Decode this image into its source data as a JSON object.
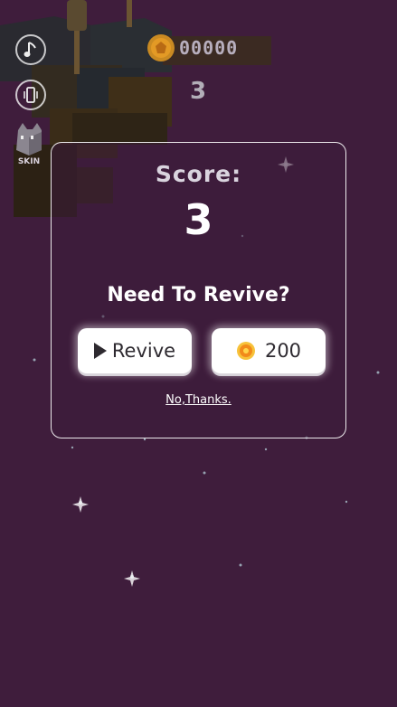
{
  "hud": {
    "music_icon": "music-note-icon",
    "vibrate_icon": "vibrate-phone-icon",
    "skin_label": "SKIN",
    "coins": "00000",
    "current_score": "3"
  },
  "dialog": {
    "score_label": "Score:",
    "score_value": "3",
    "revive_question": "Need To Revive?",
    "revive_button_label": "Revive",
    "coin_revive_cost": "200",
    "decline_label": "No,Thanks."
  },
  "colors": {
    "background": "#3f1d3c",
    "coin": "#f0a020",
    "panel_border": "#ffffff"
  }
}
